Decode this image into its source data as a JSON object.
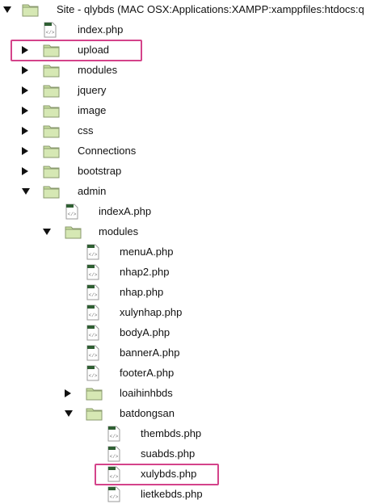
{
  "tree": {
    "site_label": "Site - qlybds (MAC OSX:Applications:XAMPP:xamppfiles:htdocs:q",
    "items": [
      {
        "label": "index.php",
        "type": "file"
      },
      {
        "label": "upload",
        "type": "folder",
        "state": "collapsed",
        "highlighted": true
      },
      {
        "label": "modules",
        "type": "folder",
        "state": "collapsed"
      },
      {
        "label": "jquery",
        "type": "folder",
        "state": "collapsed"
      },
      {
        "label": "image",
        "type": "folder",
        "state": "collapsed"
      },
      {
        "label": "css",
        "type": "folder",
        "state": "collapsed"
      },
      {
        "label": "Connections",
        "type": "folder",
        "state": "collapsed"
      },
      {
        "label": "bootstrap",
        "type": "folder",
        "state": "collapsed"
      },
      {
        "label": "admin",
        "type": "folder",
        "state": "expanded"
      },
      {
        "label": "indexA.php",
        "type": "file"
      },
      {
        "label": "modules",
        "type": "folder",
        "state": "expanded"
      },
      {
        "label": "menuA.php",
        "type": "file"
      },
      {
        "label": "nhap2.php",
        "type": "file"
      },
      {
        "label": "nhap.php",
        "type": "file"
      },
      {
        "label": "xulynhap.php",
        "type": "file"
      },
      {
        "label": "bodyA.php",
        "type": "file"
      },
      {
        "label": "bannerA.php",
        "type": "file"
      },
      {
        "label": "footerA.php",
        "type": "file"
      },
      {
        "label": "loaihinhbds",
        "type": "folder",
        "state": "collapsed"
      },
      {
        "label": "batdongsan",
        "type": "folder",
        "state": "expanded"
      },
      {
        "label": "thembds.php",
        "type": "file"
      },
      {
        "label": "suabds.php",
        "type": "file"
      },
      {
        "label": "xulybds.php",
        "type": "file",
        "highlighted": true
      },
      {
        "label": "lietkebds.php",
        "type": "file"
      }
    ]
  },
  "colors": {
    "highlight": "#d4438a",
    "folder": "#c8dea0",
    "file_badge": "#2f5f33"
  }
}
